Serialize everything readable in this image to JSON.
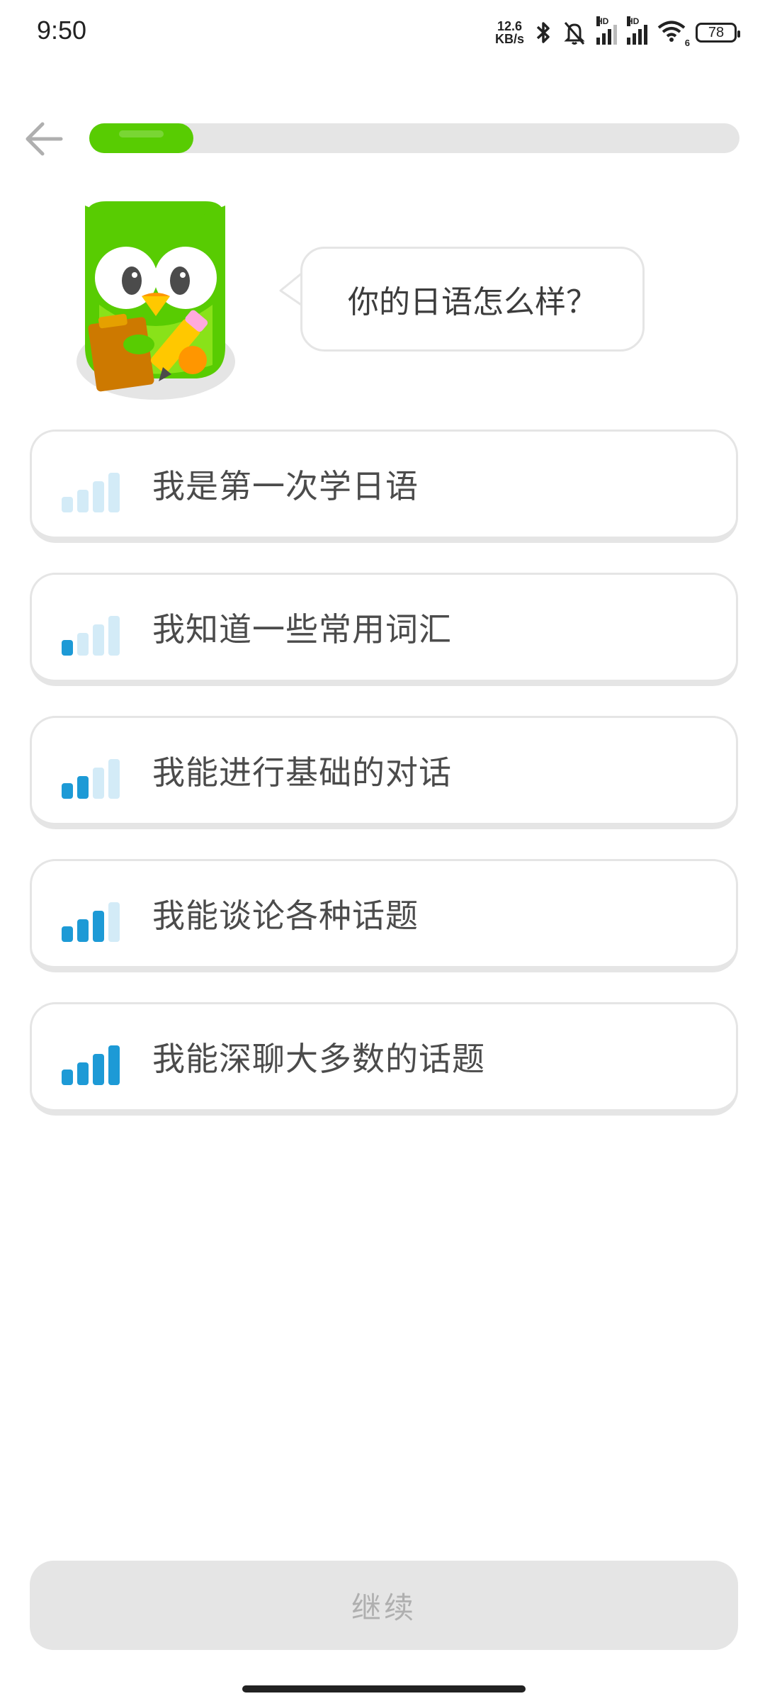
{
  "status_bar": {
    "time": "9:50",
    "net_speed_value": "12.6",
    "net_speed_unit": "KB/s",
    "hd_label_1": "HD",
    "hd_label_2": "HD",
    "wifi_sub": "6",
    "battery": "78",
    "icons": [
      "bluetooth-icon",
      "mute-bell-icon",
      "signal-icon",
      "signal-icon",
      "wifi-icon",
      "battery-icon"
    ]
  },
  "header": {
    "back_icon": "arrow-left-icon",
    "progress": 0.16
  },
  "prompt": {
    "question": "你的日语怎么样？"
  },
  "options": [
    {
      "label": "我是第一次学日语",
      "level": 0
    },
    {
      "label": "我知道一些常用词汇",
      "level": 1
    },
    {
      "label": "我能进行基础的对话",
      "level": 2
    },
    {
      "label": "我能谈论各种话题",
      "level": 3
    },
    {
      "label": "我能深聊大多数的话题",
      "level": 4
    }
  ],
  "colors": {
    "brand_green": "#58cc02",
    "bar_active": "#1d9ad6",
    "bar_inactive": "#d3ebf7",
    "border": "#e5e5e5",
    "disabled_text": "#afafaf"
  },
  "continue_button": {
    "label": "继续",
    "enabled": false
  }
}
